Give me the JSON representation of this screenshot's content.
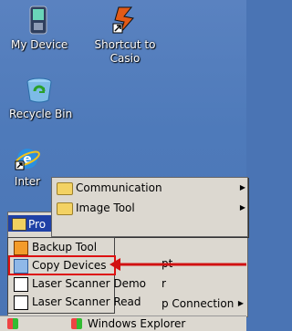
{
  "desktop": {
    "icons": [
      {
        "label": "My Device",
        "icon": "device-icon"
      },
      {
        "label": "Shortcut to\nCasio",
        "icon": "casio-shortcut-icon"
      },
      {
        "label": "Recycle Bin",
        "icon": "recycle-bin-icon"
      },
      {
        "label": "Inter",
        "icon": "internet-explorer-icon"
      }
    ]
  },
  "start_menu": {
    "items": [
      {
        "label": "Pro",
        "selected": true,
        "icon": "programs-icon"
      },
      {
        "label": "pt",
        "icon": "none"
      },
      {
        "label": "r",
        "icon": "none"
      },
      {
        "label": "p Connection",
        "icon": "none"
      }
    ]
  },
  "submenu_1": {
    "items": [
      {
        "label": "Communication",
        "icon": "folder-icon",
        "has_submenu": true
      },
      {
        "label": "Image Tool",
        "icon": "folder-icon",
        "has_submenu": true
      }
    ]
  },
  "submenu_2": {
    "items": [
      {
        "label": "Backup Tool",
        "icon": "backup-icon"
      },
      {
        "label": "Copy Devices",
        "icon": "copy-devices-icon"
      },
      {
        "label": "Laser Scanner Demo",
        "icon": "scanner-demo-icon"
      },
      {
        "label": "Laser Scanner Read",
        "icon": "scanner-read-icon"
      }
    ]
  },
  "taskbar": {
    "explorer_label": "Windows Explorer"
  },
  "colors": {
    "desktop": "#4a74b4",
    "menu_bg": "#dcd8d0",
    "selection": "#1f41a6",
    "annotation_red": "#d11111"
  }
}
